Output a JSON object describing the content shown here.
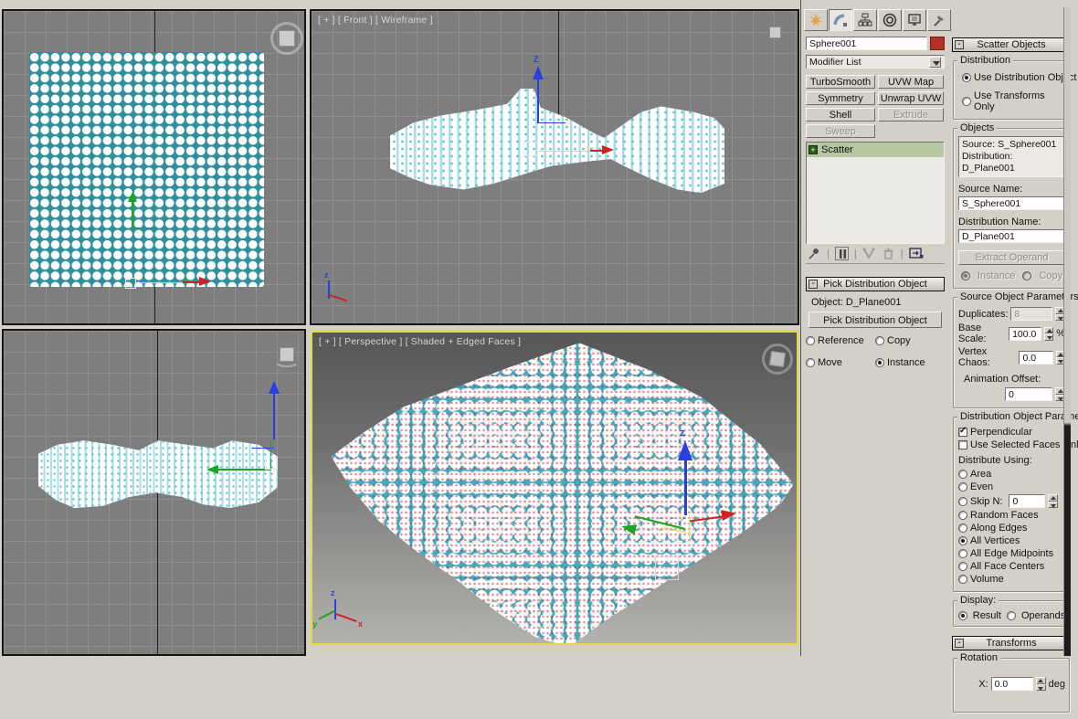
{
  "icons": {
    "minus": "-",
    "plus": "+",
    "check": "✓"
  },
  "colors": {
    "panel": "#d4d0c8",
    "object_color_swatch": "#b33226",
    "stack_selected_row": "#b7c8a0",
    "viewport_bg": "#7e7e7e",
    "active_viewport_border": "#e0d845",
    "plane_cyan": "#3fadbd",
    "gizmo_x": "#cf2222",
    "gizmo_y": "#1ea51e",
    "gizmo_z": "#2741e0"
  },
  "viewports": {
    "front": {
      "label": "[ + ] [ Front ] [ Wireframe ]",
      "gizmo_z_label": "Z"
    },
    "perspective": {
      "label": "[ + ] [ Perspective ] [ Shaded + Edged Faces ]",
      "gizmo_z_label": "z"
    },
    "axis_labels": {
      "x": "x",
      "y": "y",
      "z": "z"
    }
  },
  "command_panel": {
    "tabs": [
      {
        "id": "create",
        "label": "Create"
      },
      {
        "id": "modify",
        "label": "Modify",
        "active": true
      },
      {
        "id": "hierarchy",
        "label": "Hierarchy"
      },
      {
        "id": "motion",
        "label": "Motion"
      },
      {
        "id": "display",
        "label": "Display"
      },
      {
        "id": "utilities",
        "label": "Utilities"
      }
    ],
    "object_name": "Sphere001",
    "modifier_list_label": "Modifier List",
    "modifier_buttons": [
      {
        "label": "TurboSmooth",
        "enabled": true
      },
      {
        "label": "UVW Map",
        "enabled": true
      },
      {
        "label": "Symmetry",
        "enabled": true
      },
      {
        "label": "Unwrap UVW",
        "enabled": true
      },
      {
        "label": "Shell",
        "enabled": true
      },
      {
        "label": "Extrude",
        "enabled": false
      },
      {
        "label": "Sweep",
        "enabled": false
      }
    ],
    "modifier_stack": {
      "rows": [
        {
          "label": "Scatter",
          "selected": true
        }
      ]
    },
    "pick_rollout": {
      "title": "Pick Distribution Object",
      "object_label": "Object: D_Plane001",
      "pick_button": "Pick Distribution Object",
      "clone_options": {
        "reference": "Reference",
        "copy": "Copy",
        "move": "Move",
        "instance": "Instance",
        "selected": "Instance"
      }
    },
    "scatter_rollout": {
      "title": "Scatter Objects",
      "distribution": {
        "label": "Distribution",
        "use_distribution_object": "Use Distribution Object",
        "use_transforms_only": "Use Transforms Only",
        "selected": "Use Distribution Object"
      },
      "objects": {
        "label": "Objects",
        "list_line1": "Source: S_Sphere001",
        "list_line2": "Distribution: D_Plane001",
        "source_name_label": "Source Name:",
        "source_name": "S_Sphere001",
        "distribution_name_label": "Distribution Name:",
        "distribution_name": "D_Plane001",
        "extract_operand": "Extract Operand",
        "instance": "Instance",
        "copy": "Copy"
      },
      "source_object_parameters": {
        "label": "Source Object Parameters",
        "duplicates_label": "Duplicates:",
        "duplicates": "8",
        "base_scale_label": "Base Scale:",
        "base_scale": "100.0",
        "base_scale_unit": "%",
        "vertex_chaos_label": "Vertex Chaos:",
        "vertex_chaos": "0.0",
        "animation_offset_label": "Animation Offset:",
        "animation_offset": "0"
      },
      "distribution_object_parameters": {
        "label": "Distribution Object Parameter",
        "perpendicular": "Perpendicular",
        "perpendicular_checked": true,
        "use_selected_faces": "Use Selected Faces Only",
        "use_selected_faces_checked": false,
        "distribute_using_label": "Distribute Using:",
        "skip_n_value": "0",
        "selected": "All Vertices",
        "options": [
          {
            "label": "Area"
          },
          {
            "label": "Even"
          },
          {
            "label": "Skip N:"
          },
          {
            "label": "Random Faces"
          },
          {
            "label": "Along Edges"
          },
          {
            "label": "All Vertices"
          },
          {
            "label": "All Edge Midpoints"
          },
          {
            "label": "All Face Centers"
          },
          {
            "label": "Volume"
          }
        ]
      },
      "display": {
        "label": "Display:",
        "result": "Result",
        "operands": "Operands",
        "selected": "Result"
      }
    },
    "transforms_rollout": {
      "title": "Transforms",
      "rotation_label": "Rotation",
      "x_label": "X:",
      "x_value": "0.0",
      "x_unit": "deg"
    }
  }
}
